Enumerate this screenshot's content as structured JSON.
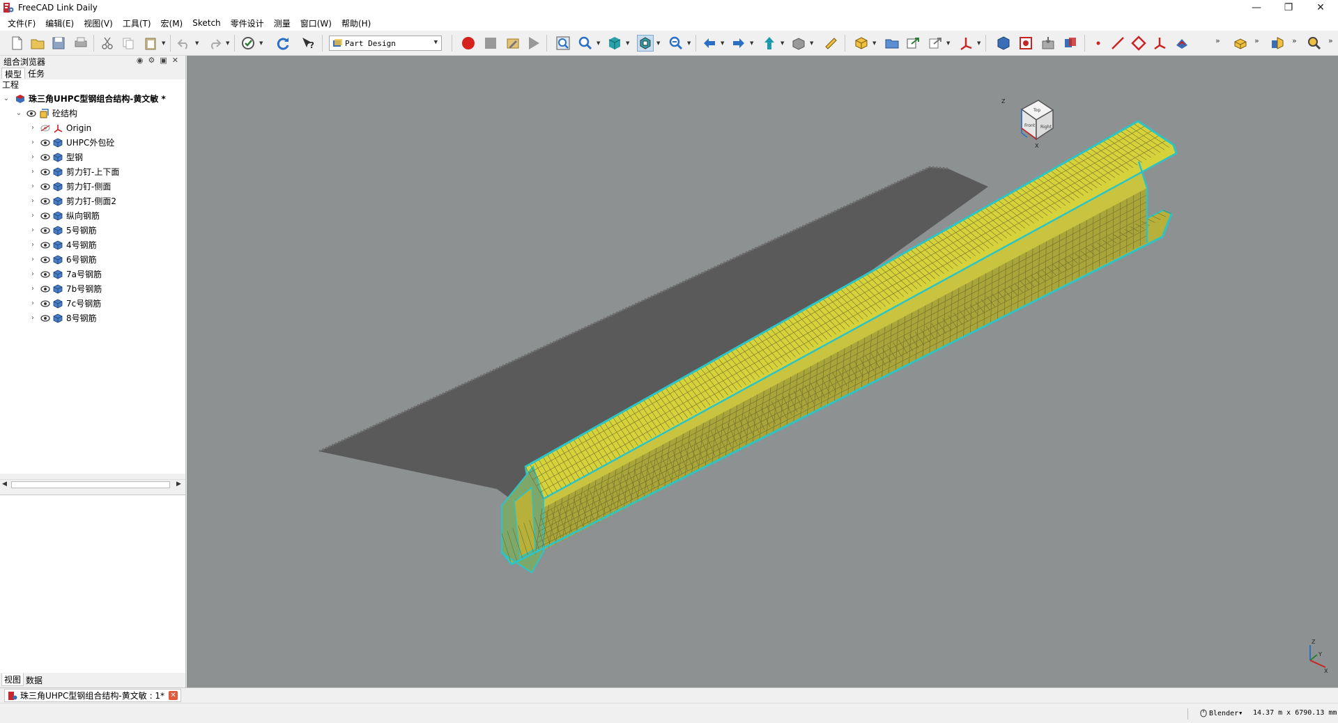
{
  "window": {
    "title": "FreeCAD Link Daily",
    "controls": {
      "minimize": "—",
      "restore": "❐",
      "close": "✕"
    }
  },
  "menu": [
    "文件(F)",
    "编辑(E)",
    "视图(V)",
    "工具(T)",
    "宏(M)",
    "Sketch",
    "零件设计",
    "测量",
    "窗口(W)",
    "帮助(H)"
  ],
  "toolbar": {
    "workbench": "Part Design",
    "icons": [
      "new-document-icon",
      "open-icon",
      "save-icon",
      "print-icon",
      "cut-icon",
      "copy-icon",
      "paste-icon",
      "undo-icon",
      "redo-icon",
      "recompute-check-icon",
      "refresh-icon",
      "whats-this-icon",
      "macro-record-icon",
      "macro-stop-icon",
      "macro-edit-icon",
      "macro-run-icon",
      "fit-all-icon",
      "zoom-icon",
      "std-view-icon",
      "draw-style-icon",
      "zoom-out-icon",
      "nav-back-icon",
      "nav-forward-icon",
      "nav-up-icon",
      "measure-box-icon",
      "measure-icon",
      "part-icon",
      "group-icon",
      "link-icon",
      "link-import-icon",
      "datum-icon",
      "body-icon",
      "shape-binder-icon",
      "sub-shape-icon",
      "clone-icon",
      "point-icon",
      "line-icon",
      "plane-icon",
      "local-cs-icon",
      "sketch-icon",
      "pad-icon",
      "feature-icon",
      "inspect-icon"
    ],
    "accent_red": "#d6221f",
    "accent_green": "#2f7d32",
    "accent_blue": "#2a6fc4"
  },
  "combo_view": {
    "title": "组合浏览器",
    "tabs": [
      "模型",
      "任务"
    ],
    "section": "工程",
    "document": "珠三角UHPC型钢组合结构-黄文敏 *",
    "body": "砼结构",
    "items": [
      {
        "label": "Origin",
        "icon": "origin-icon"
      },
      {
        "label": "UHPC外包砼",
        "icon": "feature-icon"
      },
      {
        "label": "型钢",
        "icon": "feature-icon"
      },
      {
        "label": "剪力钉-上下面",
        "icon": "feature-icon"
      },
      {
        "label": "剪力钉-侧面",
        "icon": "feature-icon"
      },
      {
        "label": "剪力钉-侧面2",
        "icon": "feature-icon"
      },
      {
        "label": "纵向钢筋",
        "icon": "feature-icon"
      },
      {
        "label": "5号钢筋",
        "icon": "feature-icon"
      },
      {
        "label": "4号钢筋",
        "icon": "feature-icon"
      },
      {
        "label": "6号钢筋",
        "icon": "feature-icon"
      },
      {
        "label": "7a号钢筋",
        "icon": "feature-icon"
      },
      {
        "label": "7b号钢筋",
        "icon": "feature-icon"
      },
      {
        "label": "7c号钢筋",
        "icon": "feature-icon"
      },
      {
        "label": "8号钢筋",
        "icon": "feature-icon"
      }
    ],
    "bottom_tabs": [
      "视图",
      "数据"
    ]
  },
  "view3d": {
    "background": "#8d9191",
    "shadow_color": "#5a5a5a",
    "beam_edge_color": "#2cc4c4",
    "rebar_color": "#e3e12c",
    "navcube": {
      "top": "Top",
      "front": "Front",
      "right": "Right",
      "axis_z": "Z",
      "axis_x": "X"
    },
    "axis": {
      "x": "X",
      "y": "Y",
      "z": "Z"
    }
  },
  "document_tab": {
    "label": "珠三角UHPC型钢组合结构-黄文敏 : 1*"
  },
  "status": {
    "navigation_style": "Blender",
    "dimensions": "14.37 m x 6790.13 mm"
  }
}
